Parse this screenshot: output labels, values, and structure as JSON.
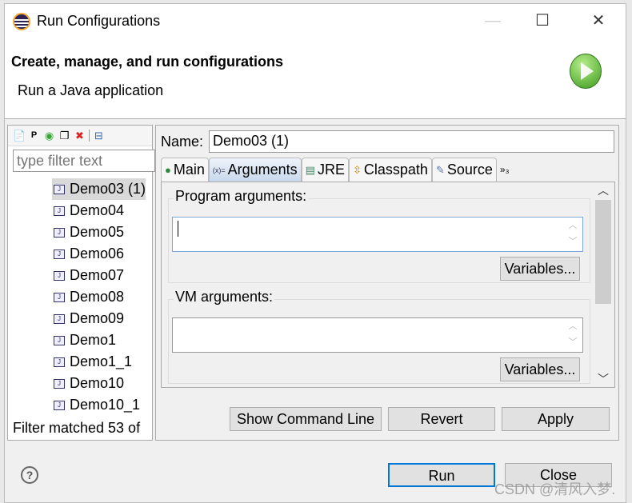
{
  "window": {
    "title": "Run Configurations"
  },
  "header": {
    "title": "Create, manage, and run configurations",
    "subtitle": "Run a Java application"
  },
  "left": {
    "filter_placeholder": "type filter text",
    "items": [
      "Demo03 (1)",
      "Demo04",
      "Demo05",
      "Demo06",
      "Demo07",
      "Demo08",
      "Demo09",
      "Demo1",
      "Demo1_1",
      "Demo10",
      "Demo10_1"
    ],
    "selected": "Demo03 (1)",
    "status": "Filter matched 53 of"
  },
  "right": {
    "name_label": "Name:",
    "name_value": "Demo03 (1)",
    "tabs": [
      {
        "label": "Main",
        "icon": "main-icon"
      },
      {
        "label": "Arguments",
        "icon": "arguments-icon"
      },
      {
        "label": "JRE",
        "icon": "jre-icon"
      },
      {
        "label": "Classpath",
        "icon": "classpath-icon"
      },
      {
        "label": "Source",
        "icon": "source-icon"
      }
    ],
    "overflow": "»₃",
    "active_tab": "Arguments",
    "program_args_label": "Program arguments:",
    "program_args_value": "",
    "vm_args_label": "VM arguments:",
    "vm_args_value": "",
    "variables_label": "Variables...",
    "show_cmd": "Show Command Line",
    "revert": "Revert",
    "apply": "Apply"
  },
  "footer": {
    "run": "Run",
    "close": "Close",
    "help": "?"
  },
  "watermark": "CSDN @清风入梦."
}
